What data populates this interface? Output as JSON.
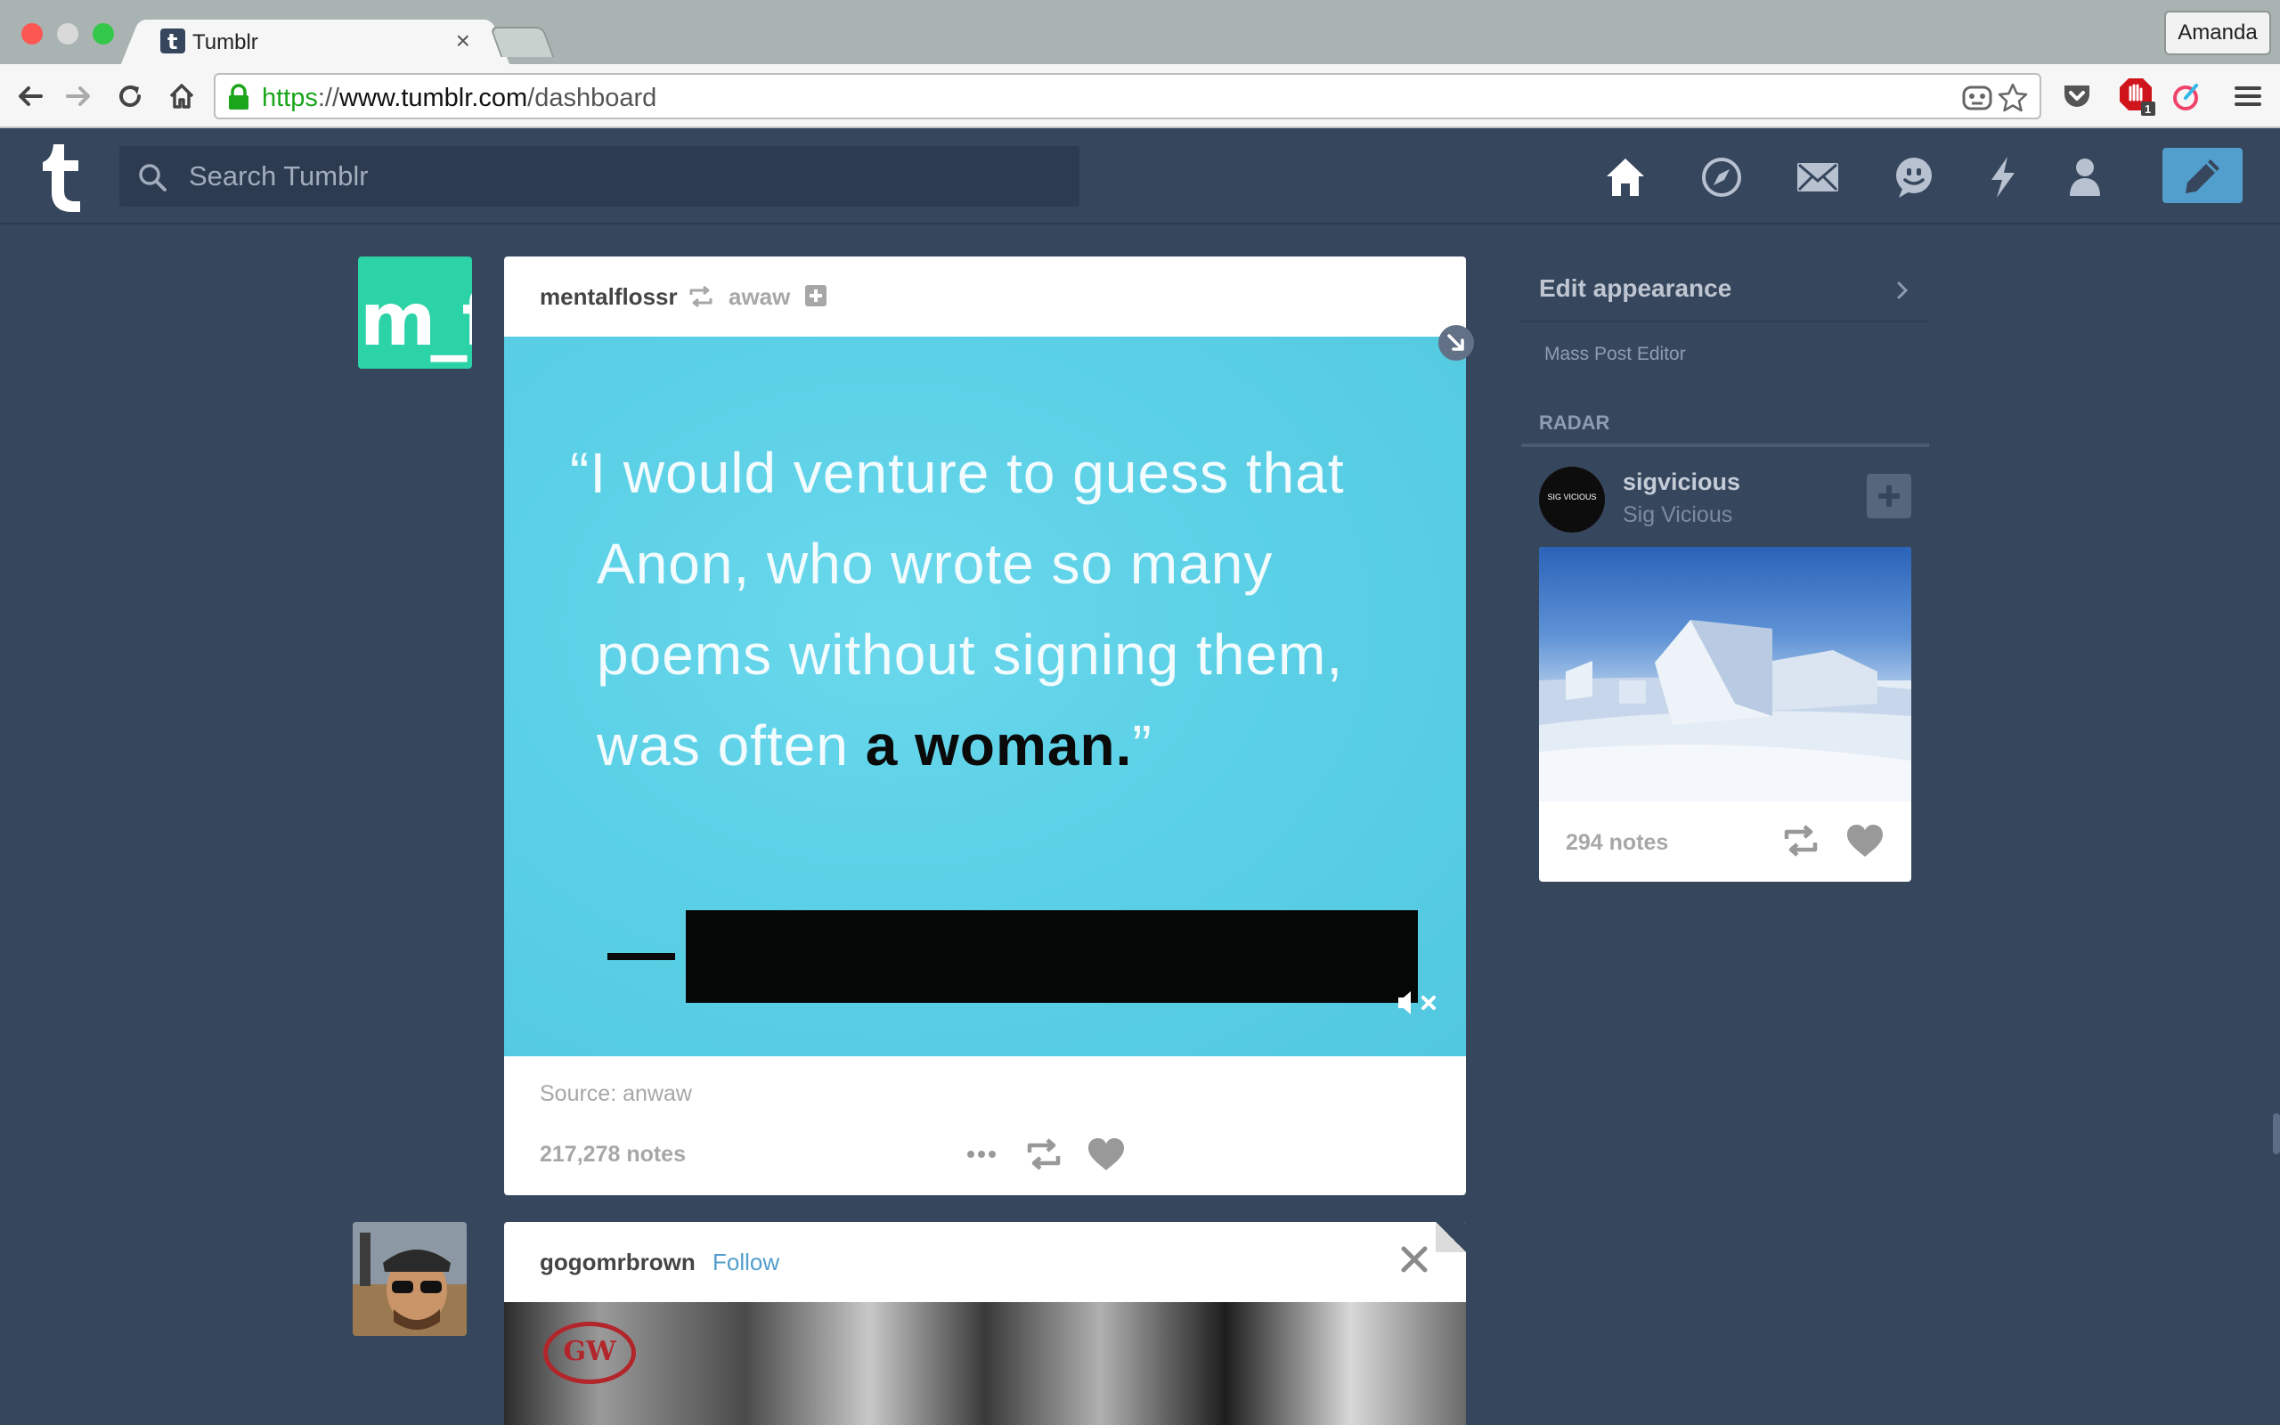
{
  "browser": {
    "tab_title": "Tumblr",
    "profile_name": "Amanda",
    "url": {
      "scheme": "https",
      "separator": "://",
      "host": "www.tumblr.com",
      "path": "/dashboard"
    },
    "extension_badge": "1"
  },
  "header": {
    "search_placeholder": "Search Tumblr",
    "nav_icons": [
      "home-icon",
      "explore-icon",
      "inbox-icon",
      "messaging-icon",
      "activity-icon",
      "account-icon",
      "compose-icon"
    ]
  },
  "post1": {
    "username": "mentalflossr",
    "reblogged_from": "awaw",
    "avatar_text": "m_f",
    "quote_lines": [
      "“I would venture to guess that",
      "Anon, who wrote so many",
      "poems without signing them,"
    ],
    "quote_last_plain": "was often ",
    "quote_last_bold": "a woman.",
    "quote_close": "”",
    "source": "Source: anwaw",
    "notes": "217,278 notes"
  },
  "post2": {
    "username": "gogomrbrown",
    "follow_label": "Follow",
    "logo_text": "GW"
  },
  "sidebar": {
    "edit_appearance": "Edit appearance",
    "mass_post_editor": "Mass Post Editor",
    "radar_label": "RADAR",
    "radar": {
      "username": "sigvicious",
      "display_name": "Sig Vicious",
      "avatar_text": "SIG VICIOUS",
      "notes": "294 notes"
    }
  },
  "colors": {
    "tumblr_navy": "#36465d",
    "compose_blue": "#529ecc",
    "quote_bg": "#5bd0e6",
    "avatar_green": "#2bd3a7"
  }
}
